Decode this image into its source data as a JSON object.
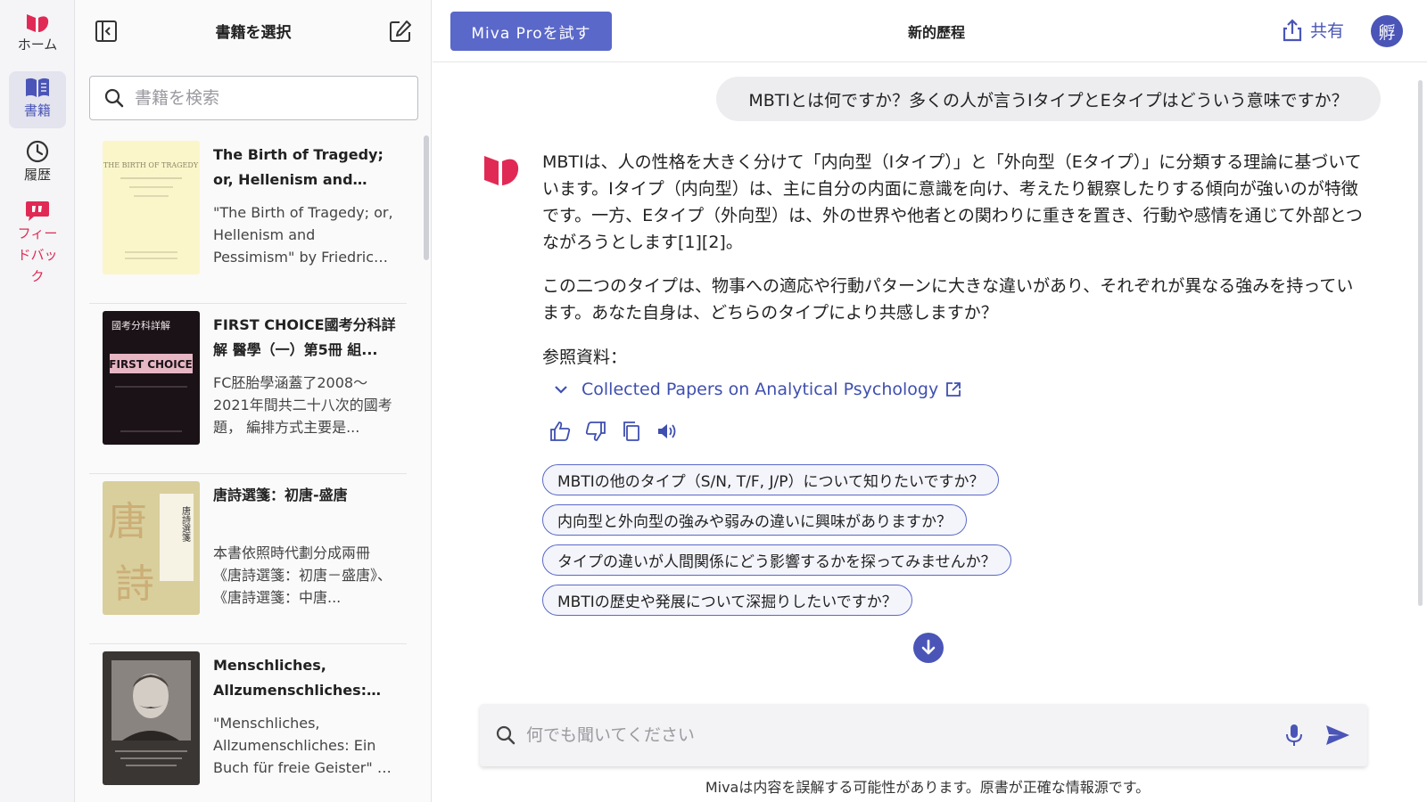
{
  "colors": {
    "accent": "#4a55b7",
    "brand_red": "#e02a55",
    "pro_button": "#5a68c9"
  },
  "rail": {
    "home_label": "ホーム",
    "books_label": "書籍",
    "history_label": "履歴",
    "feedback_label": "フィードバック"
  },
  "panel": {
    "title": "書籍を選択",
    "search_placeholder": "書籍を検索"
  },
  "books": [
    {
      "title": "The Birth of Tragedy; or, Hellenism and Pessimi...",
      "desc": "\"The Birth of Tragedy; or, Hellenism and Pessimism\" by Friedrich Wilhelm...",
      "cover_text": "THE BIRTH OF TRAGEDY"
    },
    {
      "title": "FIRST CHOICE國考分科詳解 醫學（一）第5冊 組...",
      "desc": "FC胚胎學涵蓋了2008～2021年間共二十八次的國考題， 編排方式主要是...",
      "cover_text": "FIRST CHOICE",
      "cover_subtext": "國考分科詳解"
    },
    {
      "title": "唐詩選箋：初唐-盛唐",
      "desc": "本書依照時代劃分成兩冊《唐詩選箋：初唐－盛唐》、《唐詩選箋：中唐...",
      "cover_text": "唐詩選箋"
    },
    {
      "title": "Menschliches, Allzumenschliches: Ein Buch Fuer ...",
      "desc": "\"Menschliches, Allzumenschliches: Ein Buch für freie Geister\" by Friedrich..."
    }
  ],
  "topbar": {
    "pro_button": "Miva Proを試す",
    "conversation_title": "新的歷程",
    "share_label": "共有",
    "avatar_initial": "孵"
  },
  "chat": {
    "user_message": "MBTIとは何ですか？多くの人が言うIタイプとEタイプはどういう意味ですか？",
    "answer_paragraphs": [
      "MBTIは、人の性格を大きく分けて「内向型（Iタイプ）」と「外向型（Eタイプ）」に分類する理論に基づいています。Iタイプ（内向型）は、主に自分の内面に意識を向け、考えたり観察したりする傾向が強いのが特徴です。一方、Eタイプ（外向型）は、外の世界や他者との関わりに重きを置き、行動や感情を通じて外部とつながろうとします[1][2]。",
      "この二つのタイプは、物事への適応や行動パターンに大きな違いがあり、それぞれが異なる強みを持っています。あなた自身は、どちらのタイプにより共感しますか？"
    ],
    "refs_label": "参照資料：",
    "ref_title": "Collected Papers on Analytical Psychology",
    "suggestions": [
      "MBTIの他のタイプ（S/N, T/F, J/P）について知りたいですか？",
      "内向型と外向型の強みや弱みの違いに興味がありますか？",
      "タイプの違いが人間関係にどう影響するかを探ってみませんか？",
      "MBTIの歴史や発展について深掘りしたいですか？"
    ]
  },
  "composer": {
    "placeholder": "何でも聞いてください",
    "disclaimer": "Mivaは内容を誤解する可能性があります。原書が正確な情報源です。"
  }
}
